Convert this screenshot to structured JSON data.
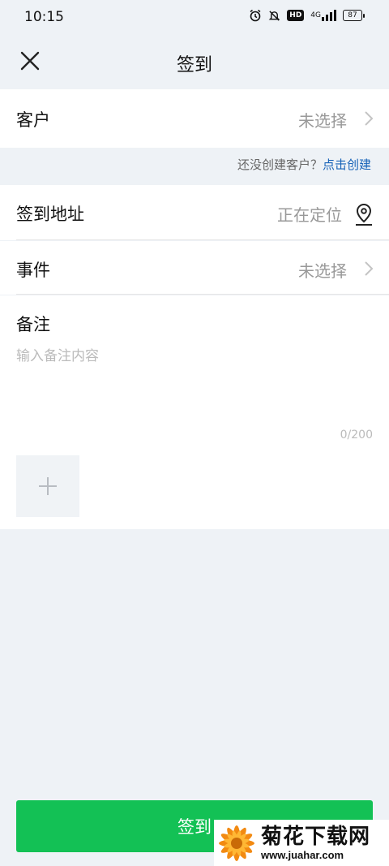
{
  "status_bar": {
    "time": "10:15",
    "network": "4G",
    "hd_badge": "HD",
    "battery": "87",
    "icons": [
      "alarm-icon",
      "bell-muted-icon",
      "hd-icon",
      "signal-icon",
      "battery-icon"
    ]
  },
  "header": {
    "title": "签到",
    "close_icon": "close-icon"
  },
  "customer": {
    "label": "客户",
    "value": "未选择"
  },
  "customer_hint": {
    "text": "还没创建客户？",
    "link": "点击创建"
  },
  "address": {
    "label": "签到地址",
    "value": "正在定位",
    "icon": "location-pin-icon"
  },
  "event": {
    "label": "事件",
    "value": "未选择"
  },
  "notes": {
    "label": "备注",
    "placeholder": "输入备注内容",
    "counter": "0/200",
    "add_icon": "plus-icon"
  },
  "submit": {
    "label": "签到"
  },
  "watermark": {
    "title": "菊花下载网",
    "url": "www.juahar.com"
  },
  "colors": {
    "accent_green": "#13c155",
    "link_blue": "#1763b8",
    "background": "#eef2f6"
  }
}
